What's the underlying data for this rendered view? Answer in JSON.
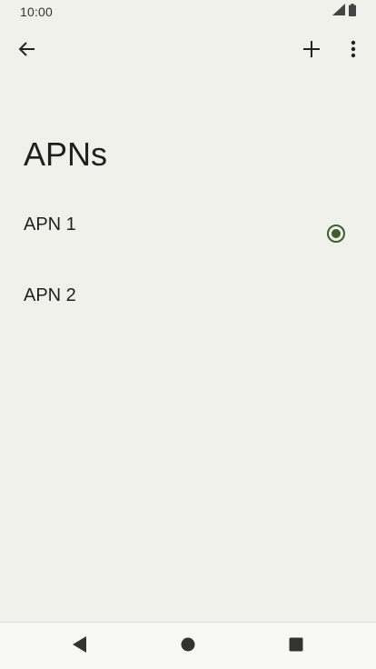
{
  "status_bar": {
    "time": "10:00"
  },
  "toolbar": {
    "back_icon": "arrow-left-icon",
    "add_icon": "plus-icon",
    "more_icon": "more-vert-icon"
  },
  "page": {
    "title": "APNs"
  },
  "apn_list": {
    "items": [
      {
        "label": "APN 1",
        "selected": true
      },
      {
        "label": "APN 2",
        "selected": false
      }
    ]
  },
  "nav_bar": {
    "back_icon": "triangle-back-icon",
    "home_icon": "circle-home-icon",
    "recents_icon": "square-recents-icon"
  },
  "colors": {
    "background": "#f1f1ec",
    "radio_accent": "#3d5f2e",
    "text": "#1f1f1f"
  }
}
